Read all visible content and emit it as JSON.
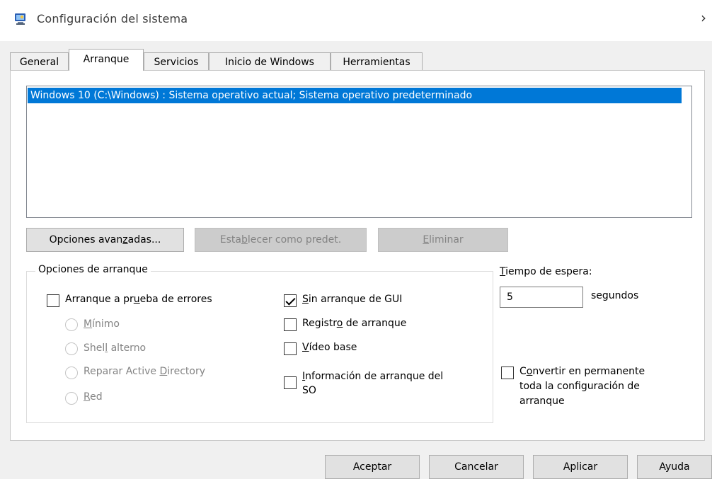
{
  "window": {
    "title": "Configuración del sistema",
    "close_glyph": "›",
    "icon": "system-config-icon"
  },
  "tabs": [
    {
      "label": "General",
      "active": false
    },
    {
      "label": "Arranque",
      "active": true
    },
    {
      "label": "Servicios",
      "active": false
    },
    {
      "label": "Inicio de Windows",
      "active": false
    },
    {
      "label": "Herramientas",
      "active": false
    }
  ],
  "boot_list": {
    "items": [
      "Windows 10 (C:\\Windows) : Sistema operativo actual; Sistema operativo predeterminado"
    ]
  },
  "list_buttons": {
    "advanced": {
      "pre": "Opciones avan",
      "u": "z",
      "post": "adas..."
    },
    "set_default": {
      "pre": "Esta",
      "u": "b",
      "post": "lecer como predet."
    },
    "delete": {
      "pre": "",
      "u": "E",
      "post": "liminar"
    }
  },
  "boot_options": {
    "group_title": "Opciones de arranque",
    "safe_boot": {
      "pre": "Arranque a pr",
      "u": "u",
      "post": "eba de errores",
      "checked": false
    },
    "minimal": {
      "pre": "",
      "u": "M",
      "post": "ínimo"
    },
    "alt_shell": {
      "pre": "Shel",
      "u": "l",
      "post": " alterno"
    },
    "ad_repair": {
      "pre": "Reparar Active ",
      "u": "D",
      "post": "irectory"
    },
    "network": {
      "pre": "",
      "u": "R",
      "post": "ed"
    },
    "no_gui": {
      "pre": "",
      "u": "S",
      "post": "in arranque de GUI",
      "checked": true
    },
    "boot_log": {
      "pre": "Registr",
      "u": "o",
      "post": " de arranque",
      "checked": false
    },
    "base_video": {
      "pre": "",
      "u": "V",
      "post": "ídeo base",
      "checked": false
    },
    "os_info": {
      "pre": "",
      "u": "I",
      "post": "nformación de arranque del",
      "line2": "SO",
      "checked": false
    }
  },
  "timeout": {
    "label_pre": "",
    "label_u": "T",
    "label_post": "iempo de espera:",
    "value": "5",
    "unit": "segundos"
  },
  "make_permanent": {
    "pre": "C",
    "u": "o",
    "post": "nvertir en permanente",
    "line2": "toda la configuración de",
    "line3": "arranque",
    "checked": false
  },
  "dialog_buttons": {
    "ok": "Aceptar",
    "cancel": "Cancelar",
    "apply": "Aplicar",
    "help": "Ayuda"
  }
}
